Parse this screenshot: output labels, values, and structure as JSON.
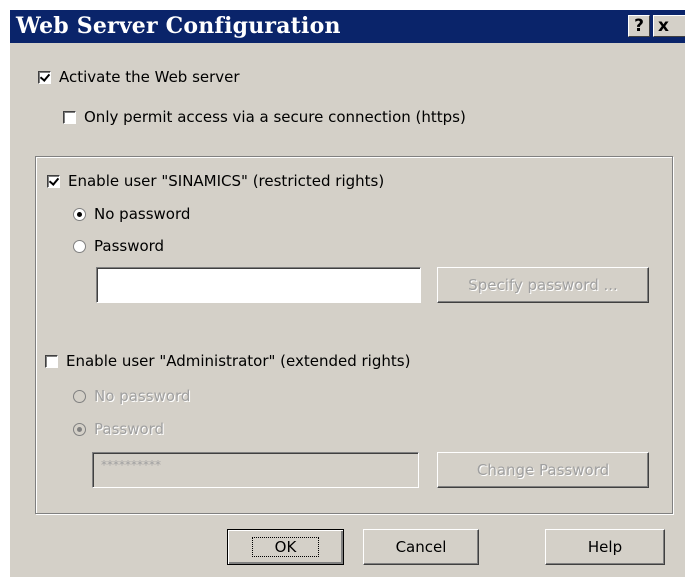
{
  "window": {
    "title": "Web Server Configuration",
    "help_glyph": "?",
    "close_glyph": "x"
  },
  "webserver": {
    "activate_label": "Activate the Web server",
    "activate_checked": true,
    "https_label": "Only permit access via a secure connection (https)",
    "https_checked": false
  },
  "user_sinamics": {
    "enable_label": "Enable user \"SINAMICS\" (restricted rights)",
    "enabled": true,
    "no_password_label": "No password",
    "password_label": "Password",
    "selected": "no_password",
    "password_value": "",
    "button_label": "Specify password ..."
  },
  "user_admin": {
    "enable_label": "Enable user \"Administrator\" (extended rights)",
    "enabled": false,
    "no_password_label": "No password",
    "password_label": "Password",
    "selected": "password",
    "password_value": "**********",
    "button_label": "Change Password"
  },
  "footer": {
    "ok_label": "OK",
    "cancel_label": "Cancel",
    "help_label": "Help"
  },
  "colors": {
    "titlebar": "#0a246a",
    "dialog_bg": "#d4d0c8",
    "disabled_text": "#a0a0a0"
  }
}
